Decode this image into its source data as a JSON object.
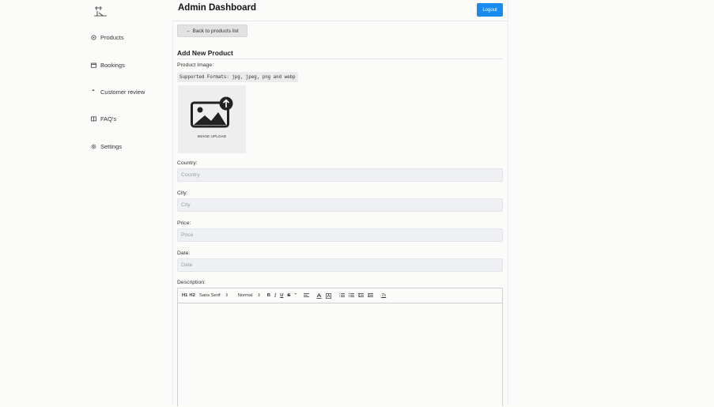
{
  "header": {
    "title": "Admin Dashboard",
    "logout_label": "Logout"
  },
  "sidebar": {
    "items": [
      {
        "label": "Products",
        "icon": "circle-dot-icon"
      },
      {
        "label": "Bookings",
        "icon": "calendar-icon"
      },
      {
        "label": "Customer review",
        "icon": "quote-icon"
      },
      {
        "label": "FAQ's",
        "icon": "book-icon"
      },
      {
        "label": "Settings",
        "icon": "gear-icon"
      }
    ]
  },
  "main": {
    "back_label": "← Back to products list",
    "section_title": "Add New Product",
    "image_label": "Product Image:",
    "formats_note": "Supported Formats: jpg, jpeg, png and webp",
    "upload_caption": "IMAGE UPLOAD",
    "fields": {
      "country": {
        "label": "Country:",
        "placeholder": "Country",
        "value": ""
      },
      "city": {
        "label": "City:",
        "placeholder": "City",
        "value": ""
      },
      "price": {
        "label": "Price:",
        "placeholder": "Price",
        "value": ""
      },
      "date": {
        "label": "Date:",
        "placeholder": "Date",
        "value": ""
      }
    },
    "description_label": "Description:",
    "editor": {
      "h1": "H1",
      "h2": "H2",
      "font": "Sans Serif",
      "size": "Normal",
      "bold": "B",
      "italic": "I",
      "underline": "U",
      "strike": "S",
      "quote": "”",
      "clear": "Tx"
    }
  },
  "colors": {
    "accent": "#1a8cf0",
    "field_bg": "#eef0f3",
    "page_bg": "#fbfbfa"
  }
}
